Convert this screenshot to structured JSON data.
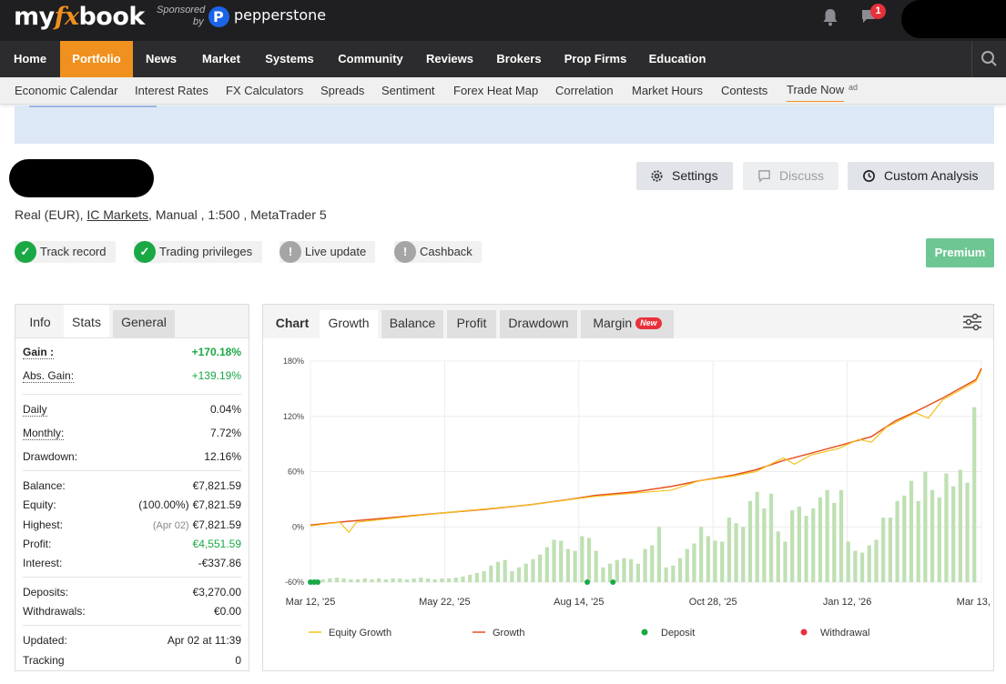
{
  "brand": {
    "logo_pre": "my",
    "logo_fx": "fx",
    "logo_post": "book",
    "sponsored": "Sponsored",
    "by": "by",
    "sponsor_name": "pepperstone"
  },
  "notifications": {
    "chat_count": "1"
  },
  "main_nav": [
    "Home",
    "Portfolio",
    "News",
    "Market",
    "Systems",
    "Community",
    "Reviews",
    "Brokers",
    "Prop Firms",
    "Education"
  ],
  "sub_nav": [
    "Economic Calendar",
    "Interest Rates",
    "FX Calculators",
    "Spreads",
    "Sentiment",
    "Forex Heat Map",
    "Correlation",
    "Market Hours",
    "Contests",
    "Trade Now"
  ],
  "sub_nav_ad": "ad",
  "account": {
    "actions": {
      "settings": "Settings",
      "discuss": "Discuss",
      "custom": "Custom Analysis"
    },
    "info": {
      "pre": "Real (EUR), ",
      "broker": "IC Markets",
      "post": ", Manual , 1:500 , MetaTrader 5"
    },
    "badges": [
      {
        "label": "Track record",
        "status": "verified"
      },
      {
        "label": "Trading privileges",
        "status": "verified"
      },
      {
        "label": "Live update",
        "status": "unavailable"
      },
      {
        "label": "Cashback",
        "status": "unavailable"
      }
    ],
    "premium": "Premium"
  },
  "stats_tabs": [
    "Info",
    "Stats",
    "General"
  ],
  "stats": {
    "gain": {
      "label": "Gain :",
      "value": "+170.18%"
    },
    "abs_gain": {
      "label": "Abs. Gain:",
      "value": "+139.19%"
    },
    "daily": {
      "label": "Daily",
      "value": "0.04%"
    },
    "monthly": {
      "label": "Monthly:",
      "value": "7.72%"
    },
    "drawdown": {
      "label": "Drawdown:",
      "value": "12.16%"
    },
    "balance": {
      "label": "Balance:",
      "value": "€7,821.59"
    },
    "equity": {
      "label": "Equity:",
      "note": "(100.00%)",
      "value": "€7,821.59"
    },
    "highest": {
      "label": "Highest:",
      "note": "(Apr 02)",
      "value": "€7,821.59"
    },
    "profit": {
      "label": "Profit:",
      "value": "€4,551.59"
    },
    "interest": {
      "label": "Interest:",
      "value": "-€337.86"
    },
    "deposits": {
      "label": "Deposits:",
      "value": "€3,270.00"
    },
    "withdrawals": {
      "label": "Withdrawals:",
      "value": "€0.00"
    },
    "updated": {
      "label": "Updated:",
      "value": "Apr 02 at 11:39"
    },
    "tracking": {
      "label": "Tracking",
      "value": "0"
    }
  },
  "chart_tabs": {
    "title": "Chart",
    "tabs": [
      "Growth",
      "Balance",
      "Profit",
      "Drawdown",
      "Margin"
    ],
    "new_badge": "New"
  },
  "colors": {
    "brand_orange": "#f0901e",
    "gain_green": "#1aa845",
    "growth_line": "#e8511e",
    "equity_line": "#f2c21d",
    "deposit": "#1aa845",
    "withdrawal": "#e8303b",
    "bar_fill": "#bfe0b3"
  },
  "chart_data": {
    "type": "line",
    "x_ticks": [
      "Mar 12, '25",
      "May 22, '25",
      "Aug 14, '25",
      "Oct 28, '25",
      "Jan 12, '26",
      "Mar 13, '26"
    ],
    "y_ticks": [
      "180%",
      "120%",
      "60%",
      "0%",
      "-60%"
    ],
    "ylim": [
      -60,
      180
    ],
    "xlim": [
      "2025-03-12",
      "2026-03-13"
    ],
    "grid": true,
    "legend_position": "bottom",
    "legend": [
      "Equity Growth",
      "Growth",
      "Deposit",
      "Withdrawal"
    ],
    "series": [
      {
        "name": "Growth",
        "points": [
          [
            "2025-03-12",
            2
          ],
          [
            "2025-04-01",
            6
          ],
          [
            "2025-04-25",
            10
          ],
          [
            "2025-05-22",
            15
          ],
          [
            "2025-06-15",
            19
          ],
          [
            "2025-07-10",
            24
          ],
          [
            "2025-08-01",
            30
          ],
          [
            "2025-08-14",
            34
          ],
          [
            "2025-09-05",
            38
          ],
          [
            "2025-09-25",
            44
          ],
          [
            "2025-10-10",
            50
          ],
          [
            "2025-10-28",
            56
          ],
          [
            "2025-11-10",
            62
          ],
          [
            "2025-11-25",
            72
          ],
          [
            "2025-12-10",
            80
          ],
          [
            "2025-12-25",
            88
          ],
          [
            "2026-01-12",
            98
          ],
          [
            "2026-01-25",
            115
          ],
          [
            "2026-02-05",
            125
          ],
          [
            "2026-02-20",
            140
          ],
          [
            "2026-03-01",
            150
          ],
          [
            "2026-03-10",
            160
          ],
          [
            "2026-03-13",
            172
          ]
        ]
      },
      {
        "name": "Equity Growth",
        "points": [
          [
            "2025-03-12",
            1
          ],
          [
            "2025-03-28",
            5
          ],
          [
            "2025-04-02",
            -6
          ],
          [
            "2025-04-06",
            5
          ],
          [
            "2025-05-22",
            15
          ],
          [
            "2025-07-10",
            24
          ],
          [
            "2025-08-14",
            33
          ],
          [
            "2025-09-25",
            40
          ],
          [
            "2025-10-10",
            50
          ],
          [
            "2025-10-28",
            55
          ],
          [
            "2025-11-10",
            60
          ],
          [
            "2025-11-25",
            75
          ],
          [
            "2025-12-01",
            68
          ],
          [
            "2025-12-10",
            78
          ],
          [
            "2025-12-25",
            85
          ],
          [
            "2026-01-05",
            95
          ],
          [
            "2026-01-12",
            92
          ],
          [
            "2026-01-20",
            108
          ],
          [
            "2026-02-05",
            124
          ],
          [
            "2026-02-12",
            118
          ],
          [
            "2026-02-20",
            138
          ],
          [
            "2026-03-01",
            148
          ],
          [
            "2026-03-10",
            158
          ],
          [
            "2026-03-13",
            170
          ]
        ]
      }
    ],
    "bars": [
      3,
      3,
      4,
      5,
      4,
      3,
      3,
      4,
      3,
      4,
      3,
      4,
      4,
      3,
      4,
      5,
      4,
      3,
      4,
      4,
      5,
      6,
      8,
      10,
      12,
      18,
      22,
      24,
      12,
      16,
      20,
      25,
      30,
      38,
      46,
      45,
      36,
      34,
      50,
      48,
      34,
      16,
      20,
      24,
      26,
      25,
      20,
      36,
      40,
      60,
      16,
      18,
      26,
      36,
      42,
      60,
      50,
      45,
      44,
      70,
      64,
      60,
      88,
      98,
      80,
      96,
      55,
      44,
      78,
      82,
      72,
      80,
      92,
      100,
      86,
      100,
      44,
      34,
      32,
      40,
      46,
      70,
      70,
      88,
      94,
      110,
      88,
      120,
      100,
      92,
      118,
      104,
      122,
      108,
      190
    ],
    "deposits": [
      "2025-03-12",
      "2025-03-14",
      "2025-03-16",
      "2025-08-10",
      "2025-08-24"
    ],
    "withdrawals": []
  }
}
